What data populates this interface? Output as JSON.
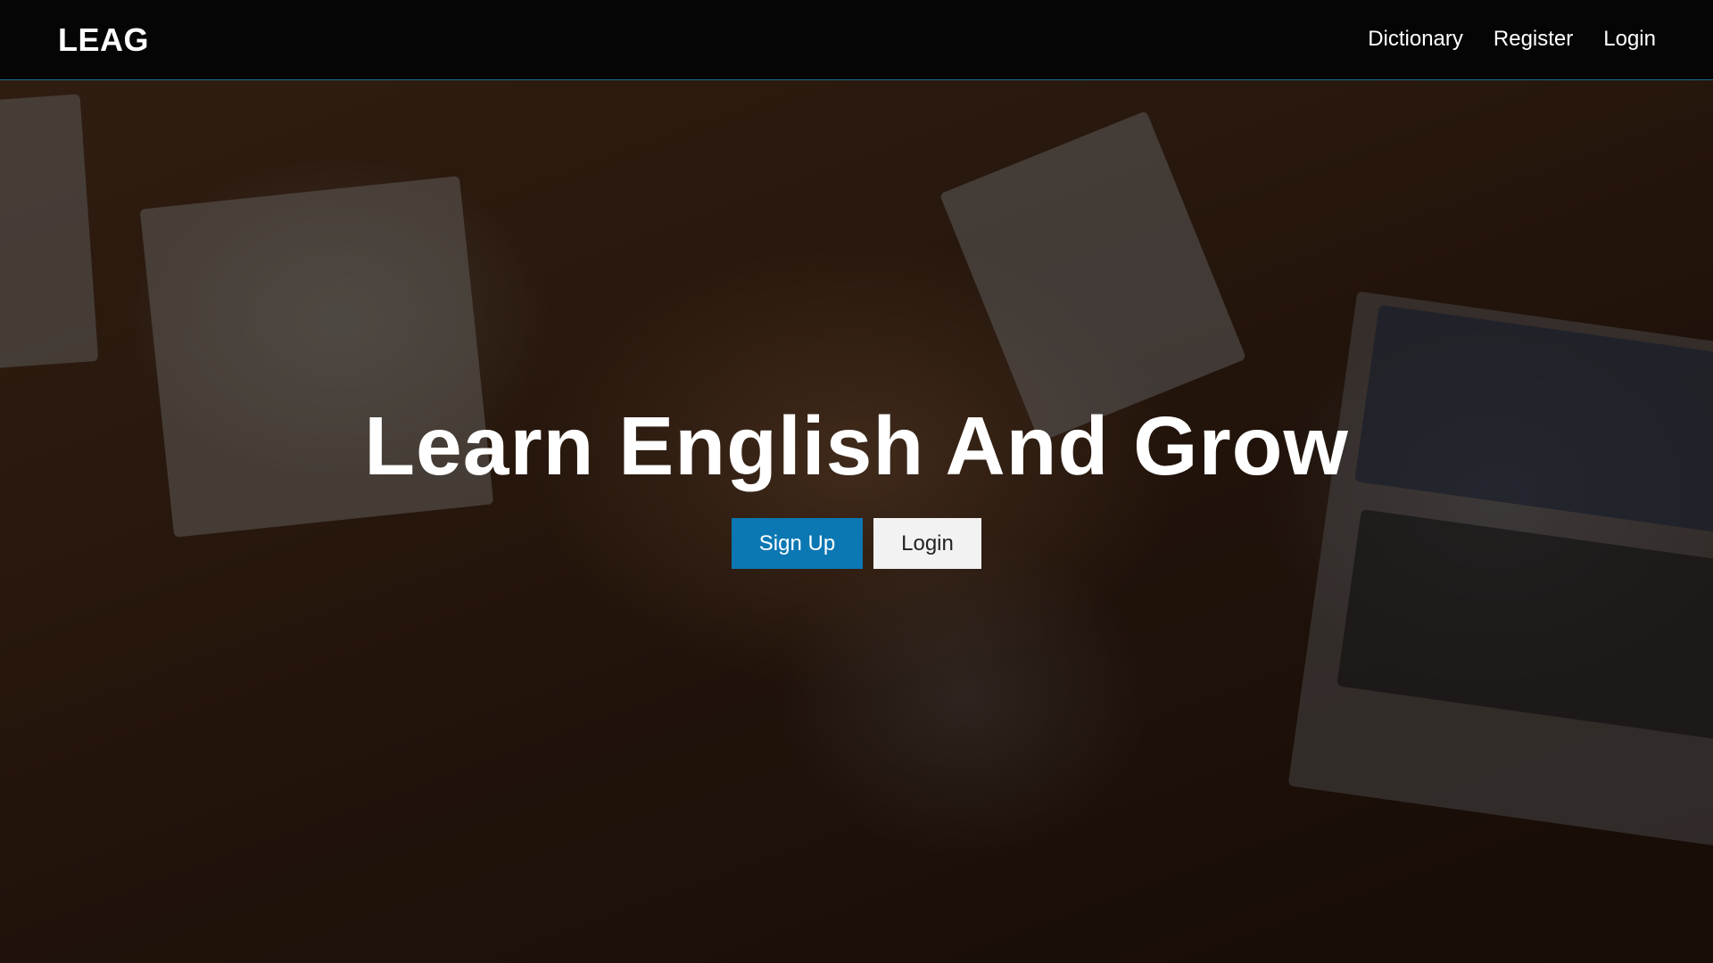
{
  "navbar": {
    "brand": "LEAG",
    "links": [
      {
        "label": "Dictionary"
      },
      {
        "label": "Register"
      },
      {
        "label": "Login"
      }
    ]
  },
  "hero": {
    "title": "Learn English And Grow",
    "primary_button": "Sign Up",
    "secondary_button": "Login"
  },
  "colors": {
    "navbar_bg": "#050505",
    "navbar_border": "#1f6d92",
    "primary_button": "#0b77b3",
    "secondary_button": "#f2f2f2"
  }
}
